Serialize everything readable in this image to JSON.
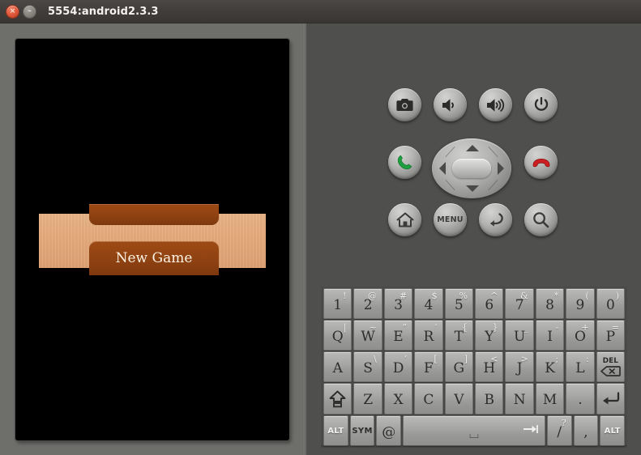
{
  "window": {
    "title": "5554:android2.3.3",
    "close_glyph": "×",
    "minimize_glyph": "–"
  },
  "device_screen": {
    "background_color": "#000000",
    "panel_color": "#e6ab7c",
    "game": {
      "top_button_label": "",
      "new_game_label": "New Game",
      "button_color": "#8f4212",
      "text_color": "#fdf3e4"
    }
  },
  "controls": {
    "row1": [
      {
        "name": "camera-button",
        "icon": "camera-icon"
      },
      {
        "name": "volume-down-button",
        "icon": "volume-down-icon"
      },
      {
        "name": "volume-up-button",
        "icon": "volume-up-icon"
      },
      {
        "name": "power-button",
        "icon": "power-icon"
      }
    ],
    "row2": [
      {
        "name": "call-button",
        "icon": "phone-call-icon",
        "color": "#1f9e3f"
      },
      {
        "name": "end-call-button",
        "icon": "phone-hangup-icon",
        "color": "#cc1f22"
      }
    ],
    "dpad": {
      "up": "dpad-up-arrow",
      "down": "dpad-down-arrow",
      "left": "dpad-left-arrow",
      "right": "dpad-right-arrow",
      "center": "dpad-center-button"
    },
    "row3": [
      {
        "name": "home-button",
        "icon": "home-icon",
        "label": ""
      },
      {
        "name": "menu-button",
        "icon": "menu-text-icon",
        "label": "MENU"
      },
      {
        "name": "back-button",
        "icon": "back-arrow-icon",
        "label": ""
      },
      {
        "name": "search-button",
        "icon": "search-icon",
        "label": ""
      }
    ]
  },
  "keyboard": {
    "row1": [
      {
        "main": "1",
        "alt": "!"
      },
      {
        "main": "2",
        "alt": "@"
      },
      {
        "main": "3",
        "alt": "#"
      },
      {
        "main": "4",
        "alt": "$"
      },
      {
        "main": "5",
        "alt": "%"
      },
      {
        "main": "6",
        "alt": "^"
      },
      {
        "main": "7",
        "alt": "&"
      },
      {
        "main": "8",
        "alt": "*"
      },
      {
        "main": "9",
        "alt": "("
      },
      {
        "main": "0",
        "alt": ")"
      }
    ],
    "row2": [
      {
        "main": "Q",
        "alt": "|"
      },
      {
        "main": "W",
        "alt": "~"
      },
      {
        "main": "E",
        "alt": "”"
      },
      {
        "main": "R",
        "alt": "‘"
      },
      {
        "main": "T",
        "alt": "{"
      },
      {
        "main": "Y",
        "alt": "}"
      },
      {
        "main": "U",
        "alt": "_"
      },
      {
        "main": "I",
        "alt": "-"
      },
      {
        "main": "O",
        "alt": "+"
      },
      {
        "main": "P",
        "alt": "="
      }
    ],
    "row3": [
      {
        "main": "A",
        "alt": ""
      },
      {
        "main": "S",
        "alt": "\\"
      },
      {
        "main": "D",
        "alt": "’"
      },
      {
        "main": "F",
        "alt": "["
      },
      {
        "main": "G",
        "alt": "]"
      },
      {
        "main": "H",
        "alt": "<"
      },
      {
        "main": "J",
        "alt": ">"
      },
      {
        "main": "K",
        "alt": ";"
      },
      {
        "main": "L",
        "alt": ":"
      }
    ],
    "delete_key": {
      "label": "DEL",
      "icon": "backspace-icon"
    },
    "row4": [
      {
        "main": "Z",
        "alt": ""
      },
      {
        "main": "X",
        "alt": ""
      },
      {
        "main": "C",
        "alt": ""
      },
      {
        "main": "V",
        "alt": ""
      },
      {
        "main": "B",
        "alt": ""
      },
      {
        "main": "N",
        "alt": ""
      },
      {
        "main": "M",
        "alt": ""
      },
      {
        "main": ".",
        "alt": ""
      }
    ],
    "shift_key": {
      "icon": "shift-icon"
    },
    "enter_key": {
      "icon": "enter-icon"
    },
    "row5": {
      "alt_left": "ALT",
      "sym": "SYM",
      "at": "@",
      "space": {
        "glyph": "⌴",
        "tab_icon": "tab-icon"
      },
      "slash": {
        "main": "/",
        "alt": "?"
      },
      "comma": {
        "main": ",",
        "alt": ""
      },
      "alt_right": "ALT"
    }
  }
}
